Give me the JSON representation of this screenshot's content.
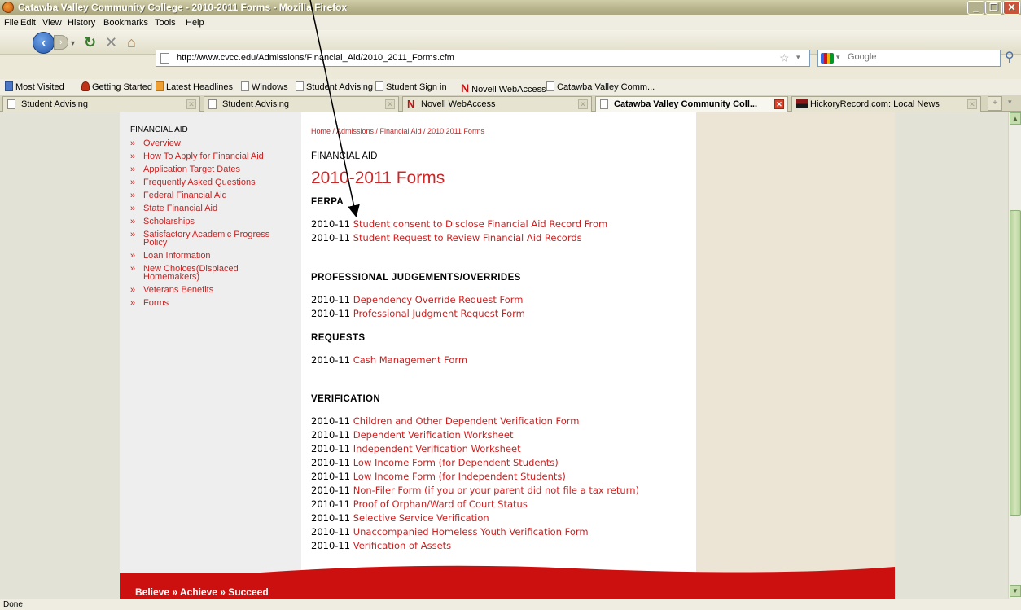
{
  "window": {
    "title": "Catawba Valley Community College - 2010-2011 Forms - Mozilla Firefox"
  },
  "menu": [
    "File",
    "Edit",
    "View",
    "History",
    "Bookmarks",
    "Tools",
    "Help"
  ],
  "nav": {
    "url": "http://www.cvcc.edu/Admissions/Financial_Aid/2010_2011_Forms.cfm",
    "search_placeholder": "Google"
  },
  "bookmarks": [
    "Most Visited",
    "Getting Started",
    "Latest Headlines",
    "Windows",
    "Student Advising",
    "Student Sign in",
    "Novell WebAccess",
    "Catawba Valley Comm..."
  ],
  "tabs": [
    {
      "label": "Student Advising"
    },
    {
      "label": "Student Advising"
    },
    {
      "label": "Novell WebAccess"
    },
    {
      "label": "Catawba Valley Community Coll..."
    },
    {
      "label": "HickoryRecord.com: Local News"
    }
  ],
  "sidebar": {
    "heading": "FINANCIAL AID",
    "bullet": "»",
    "items": [
      "Overview",
      "How To Apply for Financial Aid",
      "Application Target Dates",
      "Frequently Asked Questions",
      "Federal Financial Aid",
      "State Financial Aid",
      "Scholarships",
      "Satisfactory Academic Progress Policy",
      "Loan Information",
      "New Choices(Displaced Homemakers)",
      "Veterans Benefits",
      "Forms"
    ]
  },
  "breadcrumb": "Home / Admissions / Financial Aid / 2010 2011 Forms",
  "section_label": "FINANCIAL AID",
  "page_title": "2010-2011 Forms",
  "year_prefix": "2010-11",
  "groups": [
    {
      "heading": "FERPA",
      "items": [
        "Student consent to Disclose Financial Aid Record From",
        "Student Request to Review Financial Aid Records"
      ]
    },
    {
      "heading": "PROFESSIONAL JUDGEMENTS/OVERRIDES",
      "items": [
        "Dependency Override Request Form",
        "Professional Judgment Request Form"
      ]
    },
    {
      "heading": "REQUESTS",
      "items": [
        "Cash Management Form"
      ]
    },
    {
      "heading": "VERIFICATION",
      "items": [
        "Children and Other Dependent Verification Form",
        "Dependent Verification Worksheet",
        "Independent Verification Worksheet",
        "Low Income Form (for Dependent Students)",
        "Low Income Form (for Independent Students)",
        "Non-Filer Form (if you or your parent did not file a tax return)",
        "Proof of Orphan/Ward of Court Status",
        "Selective Service Verification",
        "Unaccompanied Homeless Youth Verification Form",
        "Verification of Assets"
      ]
    }
  ],
  "footer_motto": "Believe » Achieve » Succeed",
  "status": "Done",
  "colors": {
    "link": "#cc1f1f",
    "footer": "#cc1010",
    "scrollbar": "#c6dcae"
  }
}
